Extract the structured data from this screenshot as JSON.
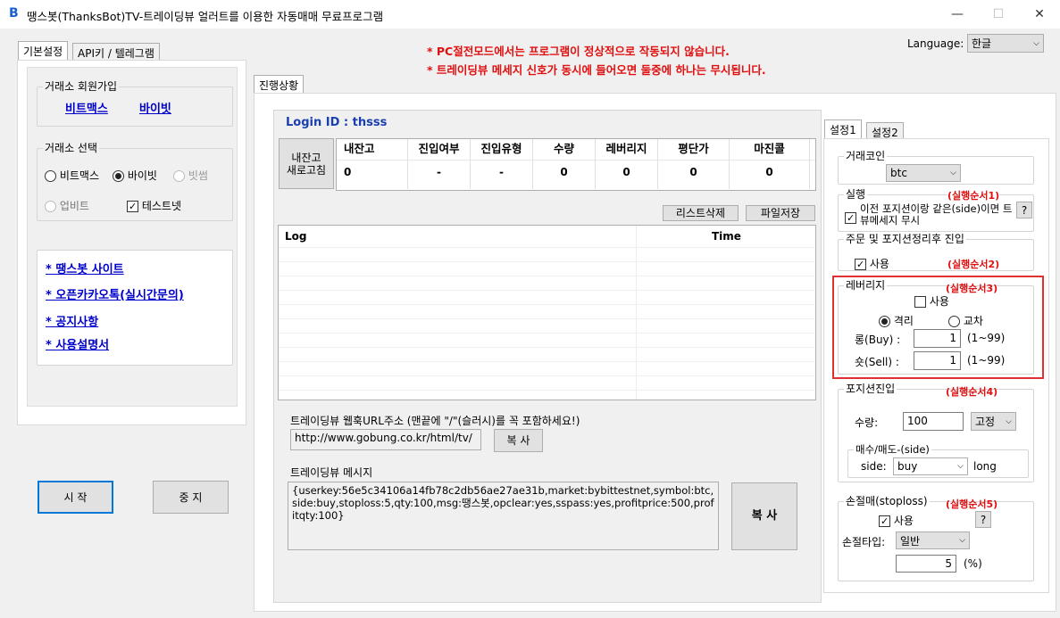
{
  "window": {
    "title": "땡스봇(ThanksBot)TV-트레이딩뷰 얼러트를 이용한 자동매매 무료프로그램",
    "minimize": "—",
    "maximize": "☐",
    "close": "✕"
  },
  "notices": [
    "* PC절전모드에서는 프로그램이 정상적으로 작동되지 않습니다.",
    "* 트레이딩뷰 메세지 신호가 동시에 들어오면 둘중에 하나는 무시됩니다."
  ],
  "language": {
    "label": "Language:",
    "value": "한글"
  },
  "left_tabs": [
    "기본설정",
    "API키 / 텔레그램"
  ],
  "signup": {
    "label": "거래소 회원가입",
    "links": [
      "비트맥스",
      "바이빗"
    ]
  },
  "exchange": {
    "label": "거래소 선택",
    "options": [
      "비트맥스",
      "바이빗",
      "빗썸",
      "업비트"
    ],
    "selected": "바이빗",
    "testnet": "테스트넷"
  },
  "links": [
    "* 땡스봇 사이트",
    "* 오픈카카오톡(실시간문의)",
    "* 공지사항",
    "* 사용설명서"
  ],
  "start_button": "시 작",
  "stop_button": "중 지",
  "main_tab": "진행상황",
  "login": "Login ID : thsss",
  "refresh_button": "내잔고\n새로고침",
  "balance": {
    "headers": [
      "내잔고",
      "진입여부",
      "진입유형",
      "수량",
      "레버리지",
      "평단가",
      "마진콜"
    ],
    "values": [
      "0",
      "-",
      "-",
      "0",
      "0",
      "0",
      "0"
    ]
  },
  "list_delete": "리스트삭제",
  "file_save": "파일저장",
  "log": {
    "col_log": "Log",
    "col_time": "Time"
  },
  "webhook": {
    "label": "트레이딩뷰 웹훅URL주소 (맨끝에 \"/\"(슬러시)를 꼭 포함하세요!)",
    "value": "http://www.gobung.co.kr/html/tv/",
    "copy": "복 사"
  },
  "message": {
    "label": "트레이딩뷰 메시지",
    "value": "{userkey:56e5c34106a14fb78c2db56ae27ae31b,market:bybittestnet,symbol:btc,side:buy,stoploss:5,qty:100,msg:땡스봇,opclear:yes,sspass:yes,profitprice:500,profitqty:100}",
    "copy": "복 사"
  },
  "settings_tabs": [
    "설정1",
    "설정2"
  ],
  "coin": {
    "label": "거래코인",
    "value": "btc"
  },
  "run": {
    "label": "실행",
    "order": "(실행순서1)",
    "check": "이전 포지션이랑 같은(side)이면 트뷰메세지 무시",
    "help": "?"
  },
  "entry_after": {
    "label": "주문 및 포지션정리후 진입",
    "check": "사용",
    "order": "(실행순서2)"
  },
  "leverage": {
    "label": "레버리지",
    "order": "(실행순서3)",
    "use": "사용",
    "isolated": "격리",
    "cross": "교차",
    "long_label": "롱(Buy) :",
    "long_value": "1",
    "short_label": "숏(Sell) :",
    "short_value": "1",
    "range": "(1~99)"
  },
  "position": {
    "label": "포지션진입",
    "order": "(실행순서4)",
    "qty_label": "수량:",
    "qty_value": "100",
    "qty_type": "고정",
    "side_group": "매수/매도-(side)",
    "side_label": "side:",
    "side_value": "buy",
    "side_after": "long"
  },
  "stoploss": {
    "label": "손절매(stoploss)",
    "order": "(실행순서5)",
    "check": "사용",
    "help": "?",
    "type_label": "손절타입:",
    "type_value": "일반",
    "value": "5",
    "unit": "(%)"
  }
}
